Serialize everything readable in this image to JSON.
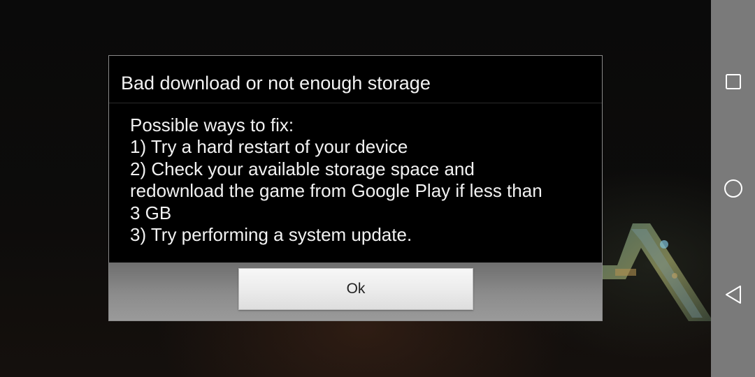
{
  "dialog": {
    "title": "Bad download or not enough storage",
    "body_lines": [
      "Possible ways to fix:",
      "1) Try a hard restart of your device",
      "2) Check your available storage space and",
      "redownload the game from Google Play if less than",
      "3 GB",
      "3) Try performing a system update."
    ],
    "ok_label": "Ok"
  },
  "nav_bar": {
    "buttons": [
      "square-recent-apps-icon",
      "circle-home-icon",
      "triangle-back-icon"
    ],
    "background_color": "#7a7a7a",
    "icon_color": "#ffffff"
  },
  "background": {
    "logo_icon": "ark-logo-icon"
  },
  "colors": {
    "dialog_background": "#000000",
    "dialog_text": "#f2f2f2",
    "button_bar": "#8c8c8c",
    "button_face": "#ececec"
  }
}
